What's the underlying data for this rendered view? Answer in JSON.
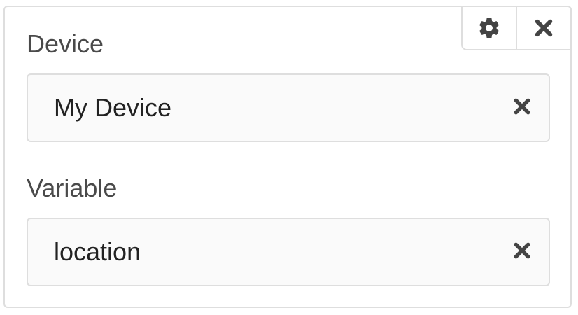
{
  "toolbar": {
    "settings_icon": "gear-icon",
    "close_icon": "close-icon"
  },
  "device": {
    "label": "Device",
    "value": "My Device",
    "clear_icon": "close-icon"
  },
  "variable": {
    "label": "Variable",
    "value": "location",
    "clear_icon": "close-icon"
  },
  "colors": {
    "border": "#dedede",
    "label_text": "#4a4a4a",
    "value_text": "#222222",
    "icon": "#444444",
    "field_bg": "#fafafa"
  }
}
